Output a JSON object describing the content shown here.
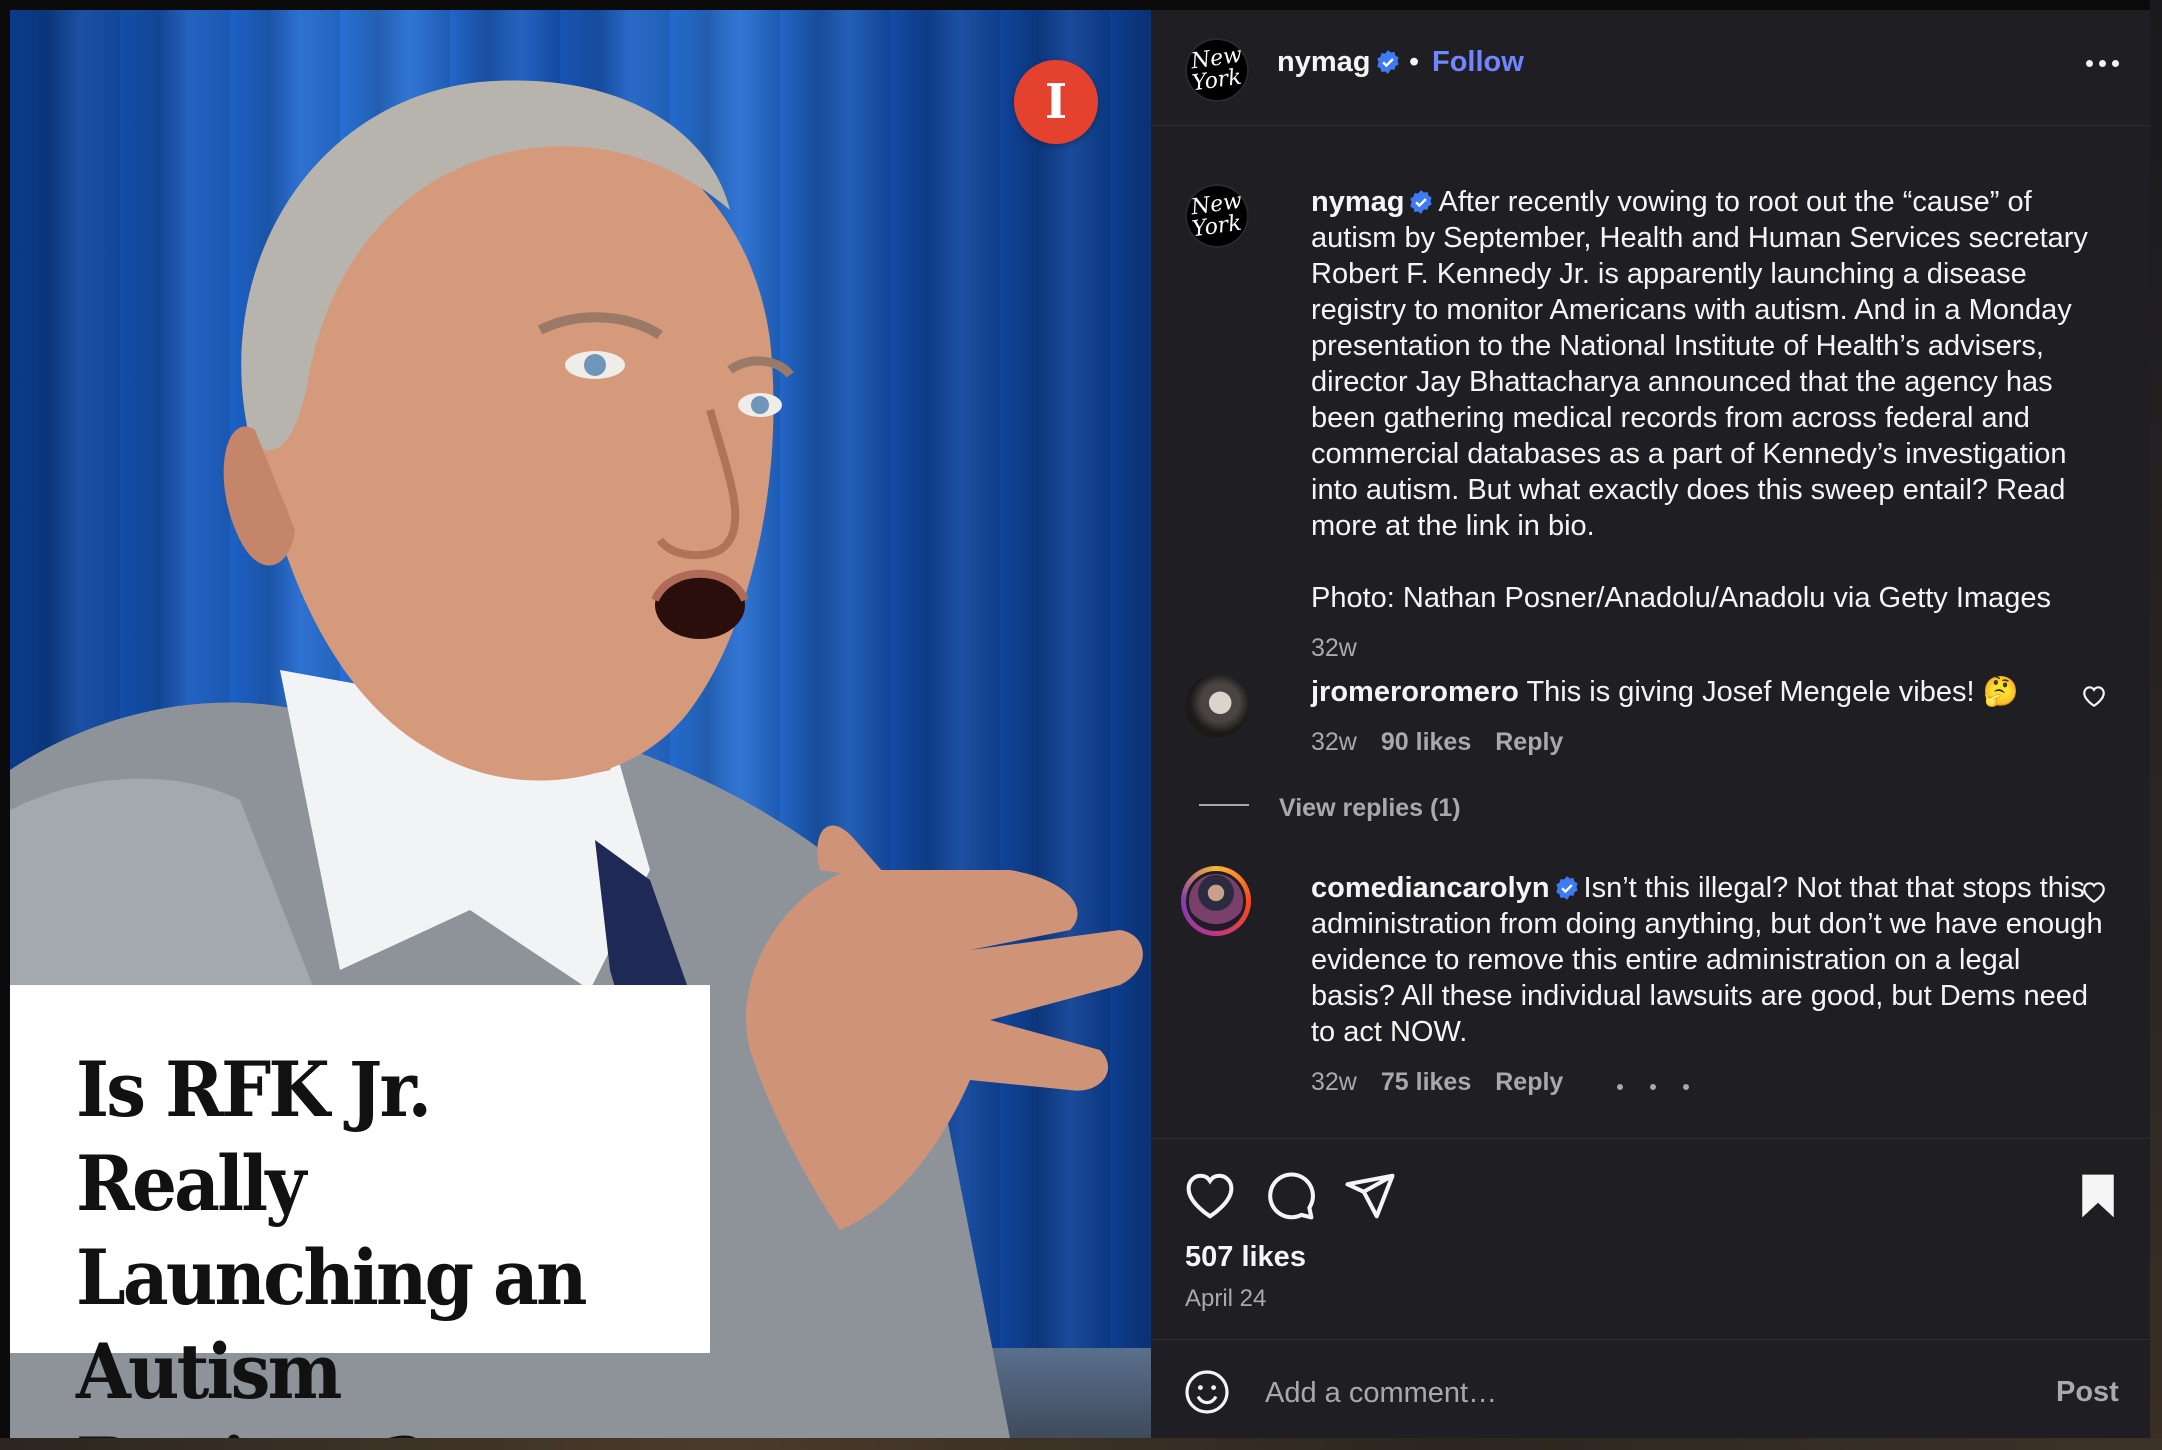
{
  "image": {
    "badge_letter": "I",
    "headline": "Is RFK Jr. Really\nLaunching an\nAutism Registry?"
  },
  "header": {
    "avatar_text_1": "New",
    "avatar_text_2": "York",
    "username": "nymag",
    "separator": "•",
    "follow_label": "Follow"
  },
  "caption": {
    "username": "nymag",
    "text": "After recently vowing to root out the “cause” of autism by September, Health and Human Services secretary Robert F. Kennedy Jr. is apparently launching a disease registry to monitor Americans with autism. And in a Monday presentation to the National Institute of Health’s advisers, director Jay Bhattacharya announced that the agency has been gathering medical records from across federal and commercial databases as a part of Kennedy’s investigation into autism. But what exactly does this sweep entail? Read more at the link in bio.",
    "credit": "Photo: Nathan Posner/Anadolu/Anadolu via Getty Images",
    "time": "32w"
  },
  "comments": [
    {
      "username": "jromeroromero",
      "text": "This is giving Josef Mengele vibes! 🤔",
      "time": "32w",
      "likes": "90 likes",
      "reply": "Reply",
      "view_replies": "View replies (1)"
    },
    {
      "username": "comediancarolyn",
      "text": "Isn’t this illegal? Not that that stops this administration from doing anything, but don’t we have enough evidence to remove this entire administration on a legal basis? All these individual lawsuits are good, but Dems need to act NOW.",
      "time": "32w",
      "likes": "75 likes",
      "reply": "Reply"
    }
  ],
  "actions": {
    "likes": "507 likes",
    "date": "April 24"
  },
  "composer": {
    "placeholder": "Add a comment…",
    "post_label": "Post"
  },
  "colors": {
    "follow": "#6f86ff",
    "verified": "#3d7bf4",
    "badge": "#e4422e"
  }
}
